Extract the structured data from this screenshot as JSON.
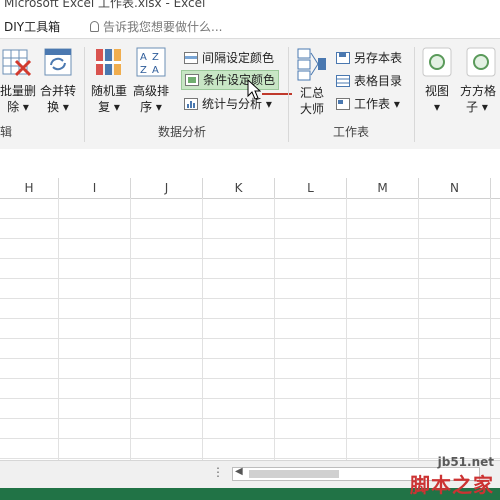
{
  "window": {
    "title": "Microsoft Excel 工作表.xlsx - Excel"
  },
  "tabs": {
    "diy": "DIY工具箱"
  },
  "tellme": {
    "placeholder": "告诉我您想要做什么..."
  },
  "ribbon": {
    "buttons": {
      "batch_delete": [
        "批量删",
        "除 ▾"
      ],
      "merge_convert": [
        "合并转",
        "换 ▾"
      ],
      "random_repeat": [
        "随机重",
        "复 ▾"
      ],
      "advanced_sort": [
        "高级排",
        "序 ▾"
      ],
      "summary_master": [
        "汇总",
        "大师"
      ],
      "view": [
        "视图",
        "▾"
      ],
      "grid": [
        "方方格",
        "子 ▾"
      ]
    },
    "small": {
      "interval_color": "间隔设定颜色",
      "condition_color": "条件设定颜色",
      "stats_analysis": "统计与分析 ▾",
      "save_sheet": "另存本表",
      "table_catalog": "表格目录",
      "worksheet": "工作表 ▾"
    },
    "groups": {
      "edit_partial": "辑",
      "data_analysis": "数据分析",
      "worksheet": "工作表"
    }
  },
  "grid": {
    "columns": [
      "H",
      "I",
      "J",
      "K",
      "L",
      "M",
      "N"
    ]
  },
  "watermark": {
    "url": "jb51.net",
    "site": "脚本之家"
  }
}
